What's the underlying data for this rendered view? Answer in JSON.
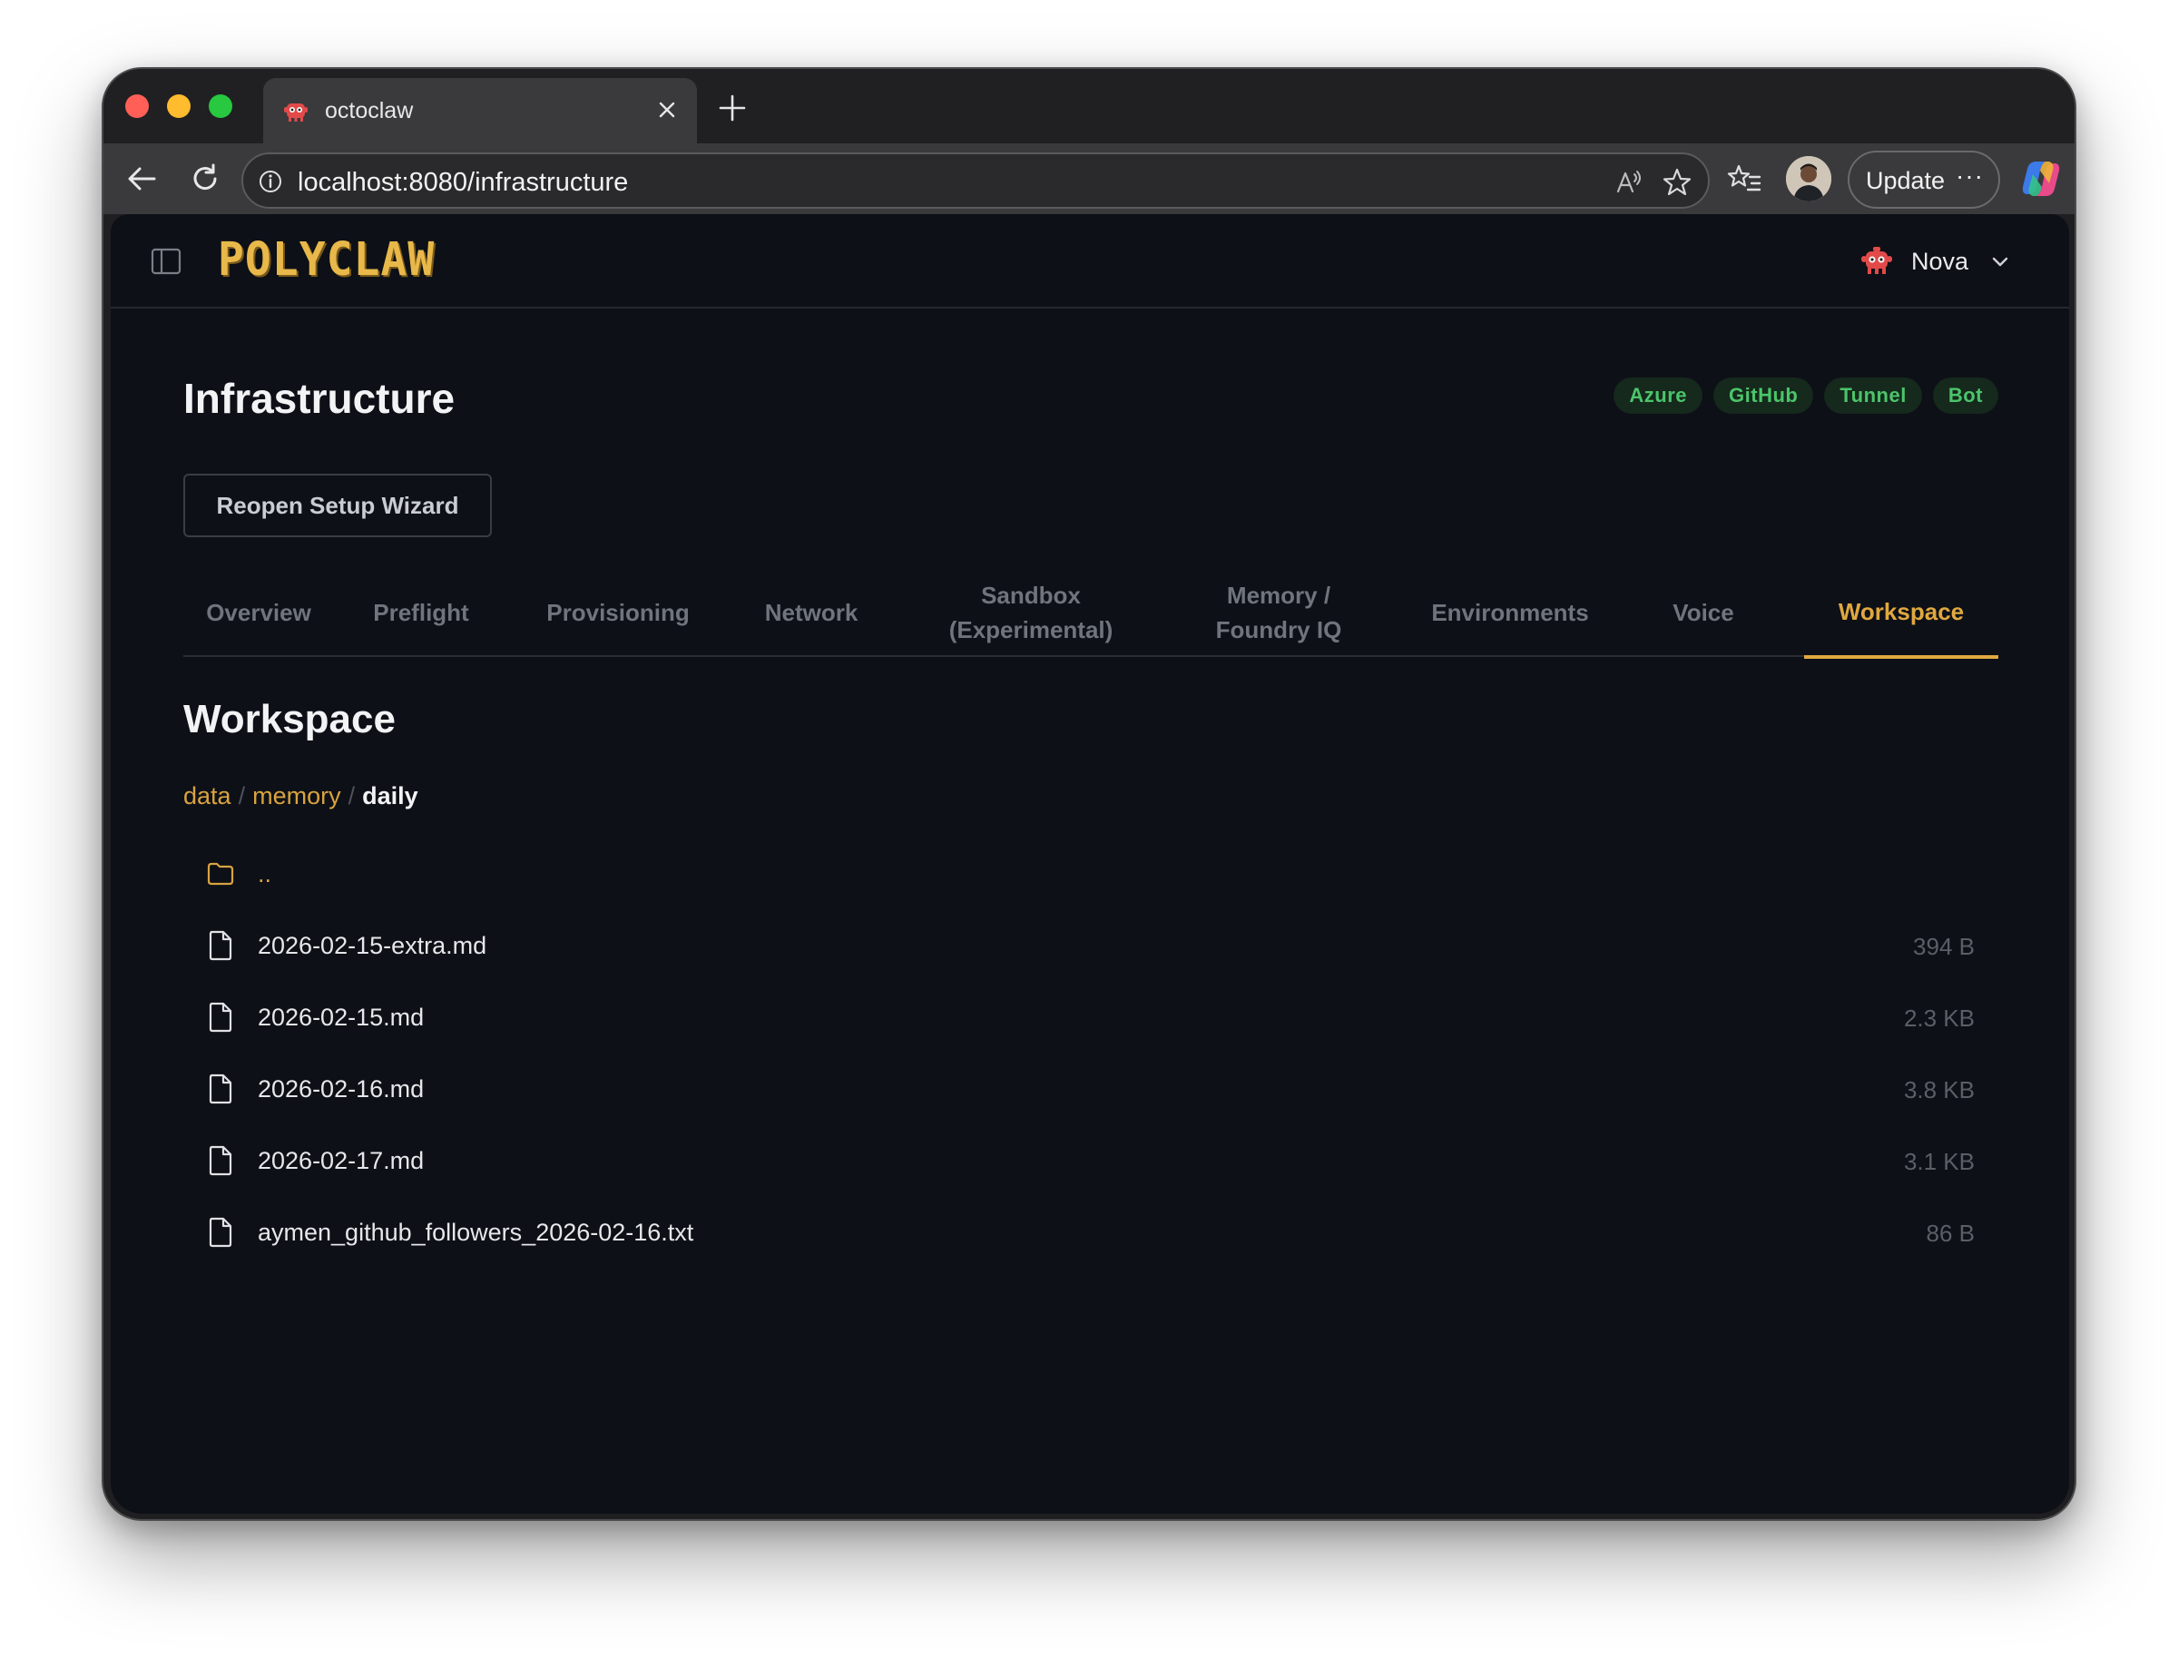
{
  "browser": {
    "tab_title": "octoclaw",
    "url": "localhost:8080/infrastructure",
    "update_label": "Update",
    "update_more": "···"
  },
  "app": {
    "logo_text": "POLYCLAW",
    "agent_name": "Nova"
  },
  "page": {
    "title": "Infrastructure",
    "badges": [
      "Azure",
      "GitHub",
      "Tunnel",
      "Bot"
    ],
    "badge_color": "#4cc46a",
    "wizard_button": "Reopen Setup Wizard",
    "accent_color": "#e0a840",
    "tabs": [
      {
        "label": "Overview"
      },
      {
        "label": "Preflight"
      },
      {
        "label": "Provisioning"
      },
      {
        "label": "Network"
      },
      {
        "label": "Sandbox (Experimental)"
      },
      {
        "label": "Memory / Foundry IQ"
      },
      {
        "label": "Environments"
      },
      {
        "label": "Voice"
      },
      {
        "label": "Workspace",
        "active": true
      }
    ]
  },
  "workspace": {
    "title": "Workspace",
    "breadcrumb": {
      "parts": [
        "data",
        "memory"
      ],
      "separator": "/",
      "current": "daily"
    },
    "parent_entry": "..",
    "files": [
      {
        "name": "2026-02-15-extra.md",
        "size": "394 B"
      },
      {
        "name": "2026-02-15.md",
        "size": "2.3 KB"
      },
      {
        "name": "2026-02-16.md",
        "size": "3.8 KB"
      },
      {
        "name": "2026-02-17.md",
        "size": "3.1 KB"
      },
      {
        "name": "aymen_github_followers_2026-02-16.txt",
        "size": "86 B"
      }
    ]
  }
}
